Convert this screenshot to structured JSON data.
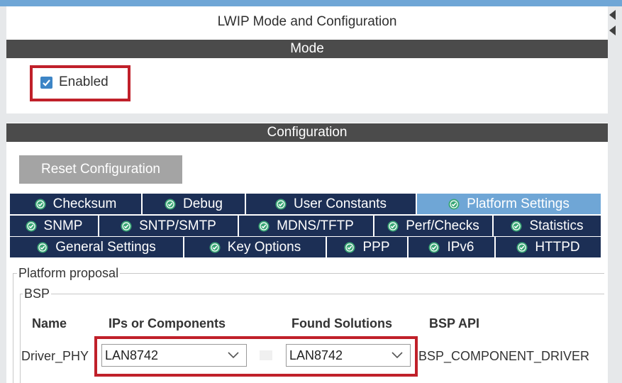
{
  "window": {
    "title": "LWIP Mode and Configuration"
  },
  "mode": {
    "header": "Mode",
    "enabled_label": "Enabled",
    "enabled_checked": true
  },
  "configuration": {
    "header": "Configuration",
    "reset_label": "Reset Configuration",
    "tabs_row1": [
      "Checksum",
      "Debug",
      "User Constants",
      "Platform Settings"
    ],
    "tabs_row2": [
      "SNMP",
      "SNTP/SMTP",
      "MDNS/TFTP",
      "Perf/Checks",
      "Statistics"
    ],
    "tabs_row3": [
      "General Settings",
      "Key Options",
      "PPP",
      "IPv6",
      "HTTPD"
    ],
    "active_tab": "Platform Settings"
  },
  "platform": {
    "group_label": "Platform proposal",
    "bsp_label": "BSP",
    "columns": [
      "Name",
      "IPs or Components",
      "Found Solutions",
      "BSP API"
    ],
    "row": {
      "name": "Driver_PHY",
      "component": "LAN8742",
      "solution": "LAN8742",
      "bsp_api": "BSP_COMPONENT_DRIVER"
    }
  },
  "colors": {
    "accent": "#6fa6d6",
    "tab_bg": "#1c2f55",
    "section_bar": "#4b4b4b",
    "highlight": "#c0202a",
    "check_ok": "#3aa876"
  }
}
